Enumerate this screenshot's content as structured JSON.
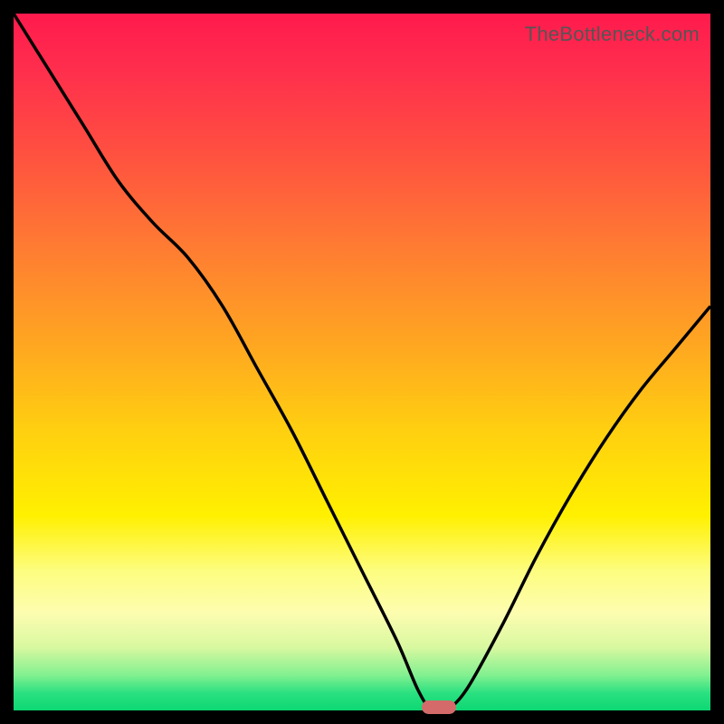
{
  "watermark": "TheBottleneck.com",
  "chart_data": {
    "type": "line",
    "title": "",
    "xlabel": "",
    "ylabel": "",
    "ylim": [
      0,
      100
    ],
    "x": [
      0,
      5,
      10,
      15,
      20,
      25,
      30,
      35,
      40,
      45,
      50,
      55,
      58,
      60,
      62,
      65,
      70,
      75,
      80,
      85,
      90,
      95,
      100
    ],
    "values": [
      100,
      92,
      84,
      76,
      70,
      65,
      58,
      49,
      40,
      30,
      20,
      10,
      3,
      0,
      0,
      3,
      12,
      22,
      31,
      39,
      46,
      52,
      58
    ],
    "background_gradient": [
      "#ff1a4d",
      "#ff7a33",
      "#fff000",
      "#0cd873"
    ],
    "marker": {
      "x": 61,
      "y": 0,
      "color": "#d46a6a"
    }
  }
}
